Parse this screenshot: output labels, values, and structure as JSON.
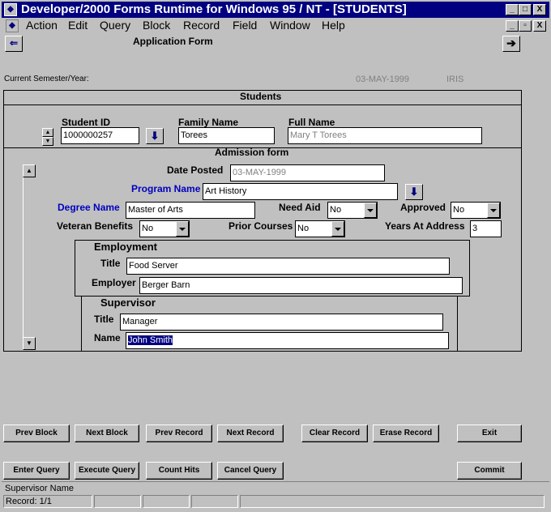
{
  "window": {
    "title": "Developer/2000 Forms Runtime for Windows 95 / NT - [STUDENTS]",
    "minimize": "_",
    "maximize": "□",
    "close": "X",
    "child_minimize": "_",
    "child_restore": "▫",
    "child_close": "X"
  },
  "menu": [
    "Action",
    "Edit",
    "Query",
    "Block",
    "Record",
    "Field",
    "Window",
    "Help"
  ],
  "header": {
    "title": "Application Form",
    "semester_label": "Current Semester/Year:",
    "semester_date": "03-MAY-1999",
    "semester_user": "IRIS"
  },
  "students": {
    "title": "Students",
    "student_id_label": "Student ID",
    "student_id": "1000000257",
    "family_name_label": "Family Name",
    "family_name": "Torees",
    "full_name_label": "Full Name",
    "full_name": "Mary T Torees"
  },
  "admission": {
    "title": "Admission form",
    "date_posted_label": "Date Posted",
    "date_posted": "03-MAY-1999",
    "program_name_label": "Program Name",
    "program_name": "Art History",
    "degree_name_label": "Degree Name",
    "degree_name": "Master of Arts",
    "need_aid_label": "Need Aid",
    "need_aid": "No",
    "approved_label": "Approved",
    "approved": "No",
    "veteran_label": "Veteran Benefits",
    "veteran": "No",
    "prior_courses_label": "Prior Courses",
    "prior_courses": "No",
    "years_label": "Years At Address",
    "years": "3"
  },
  "employment": {
    "title": "Employment",
    "title_label": "Title",
    "job_title": "Food Server",
    "employer_label": "Employer",
    "employer": "Berger Barn"
  },
  "supervisor": {
    "title": "Supervisor",
    "title_label": "Title",
    "sup_title": "Manager",
    "name_label": "Name",
    "name": "John Smith"
  },
  "buttons": {
    "prev_block": "Prev Block",
    "next_block": "Next Block",
    "prev_record": "Prev Record",
    "next_record": "Next Record",
    "clear_record": "Clear Record",
    "erase_record": "Erase Record",
    "exit": "Exit",
    "enter_query": "Enter Query",
    "execute_query": "Execute Query",
    "count_hits": "Count Hits",
    "cancel_query": "Cancel Query",
    "commit": "Commit"
  },
  "statusbar": {
    "message": "Supervisor Name",
    "record": "Record: 1/1"
  }
}
